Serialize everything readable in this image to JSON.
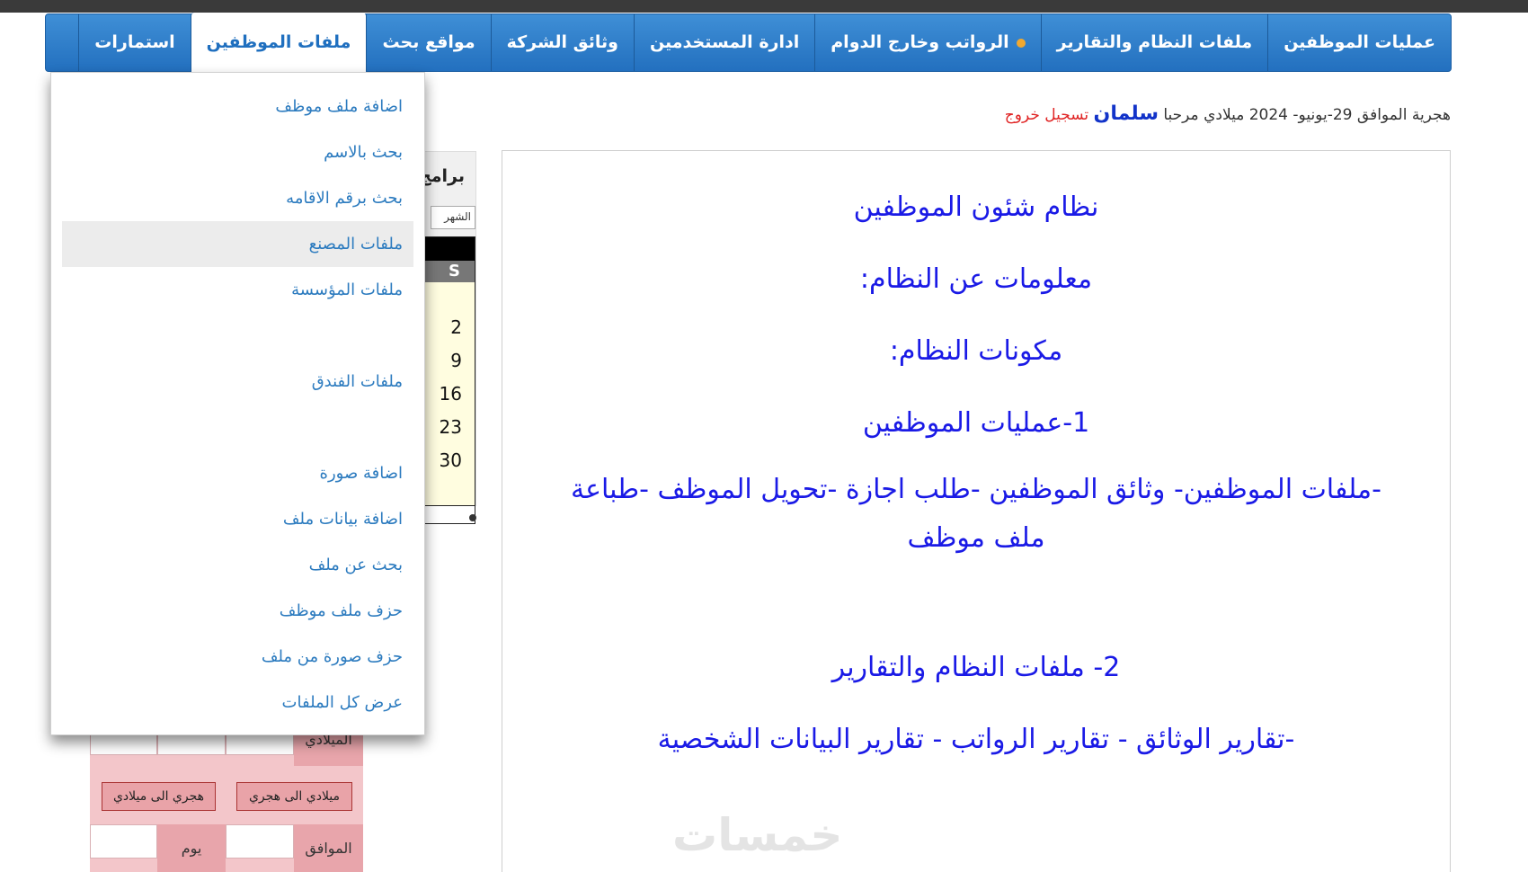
{
  "nav": {
    "items": [
      {
        "label": "عمليات الموظفين"
      },
      {
        "label": "ملفات النظام والتقارير"
      },
      {
        "label": "الرواتب وخارج الدوام"
      },
      {
        "label": "ادارة المستخدمين"
      },
      {
        "label": "وثائق الشركة"
      },
      {
        "label": "مواقع بحث"
      },
      {
        "label": "ملفات الموظفين"
      },
      {
        "label": "استمارات"
      }
    ],
    "active": "ملفات الموظفين"
  },
  "greeting": {
    "date_text": "هجرية الموافق 29-يونيو- 2024 ميلادي مرحبا",
    "username": "سلمان",
    "logout": "تسجيل خروج"
  },
  "dropdown": {
    "items": [
      "اضافة ملف موظف",
      "بحث بالاسم",
      "بحث برقم الاقامه",
      "ملفات المصنع",
      "ملفات المؤسسة",
      "ملفات الفندق",
      "اضافة صورة",
      "اضافة بيانات ملف",
      "بحث عن ملف",
      "حزف ملف موظف",
      "حزف صورة من ملف",
      "عرض كل الملفات"
    ],
    "hovered_index": 3
  },
  "content": {
    "title": "نظام شئون الموظفين",
    "about": "معلومات عن النظام:",
    "components": "مكونات النظام:",
    "section1_title": "1-عمليات الموظفين",
    "section1_text": "-ملفات الموظفين- وثائق الموظفين -طلب اجازة -تحويل الموظف -طباعة ملف موظف",
    "section2_title": "2- ملفات النظام والتقارير",
    "section2_text": "-تقارير الوثائق - تقارير الرواتب - تقارير البيانات الشخصية"
  },
  "sidepanel": {
    "title": "برامج",
    "month_placeholder": "الشهر",
    "day_header": "S",
    "days": [
      "2",
      "9",
      "16",
      "23",
      "30"
    ]
  },
  "converter": {
    "gregorian_label": "الميلادي",
    "btn_to_hijri": "ميلادي الى هجري",
    "btn_to_gregorian": "هجري الى ميلادي",
    "corresponding_label": "الموافق",
    "day_label": "يوم"
  },
  "watermark": "خمسات",
  "colors": {
    "nav_blue": "#2a7bc9",
    "link_blue": "#2c7bbf",
    "content_blue": "#1a1ae6",
    "logout_red": "#e02424",
    "converter_pink": "#f3c6ca"
  }
}
